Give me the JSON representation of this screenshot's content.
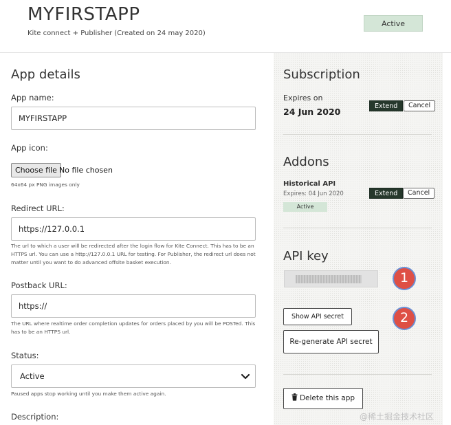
{
  "header": {
    "app_title": "MYFIRSTAPP",
    "subtitle": "Kite connect + Publisher (Created on 24 may 2020)",
    "status": "Active"
  },
  "app_details": {
    "heading": "App details",
    "app_name_label": "App name:",
    "app_name_value": "MYFIRSTAPP",
    "app_icon_label": "App icon:",
    "choose_file": "Choose file",
    "file_status": "No file chosen",
    "icon_hint": "64x64 px PNG images only",
    "redirect_label": "Redirect URL:",
    "redirect_value": "https://127.0.0.1",
    "redirect_help": "The url to which a user will be redirected after the login flow for Kite Connect. This has to be an HTTPS url. You can use a http://127.0.0.1 URL for testing. For Publisher, the redirect url does not matter until you want to do advanced offsite basket execution.",
    "postback_label": "Postback URL:",
    "postback_value": "https://",
    "postback_help": "The URL where realtime order completion updates for orders placed by you will be POSTed. This has to be an HTTPS url.",
    "status_label": "Status:",
    "status_value": "Active",
    "status_help": "Paused apps stop working until you make them active again.",
    "description_label": "Description:"
  },
  "subscription": {
    "heading": "Subscription",
    "expires_label": "Expires on",
    "expires_date": "24 Jun 2020",
    "extend": "Extend",
    "cancel": "Cancel"
  },
  "addons": {
    "heading": "Addons",
    "name": "Historical API",
    "expires": "Expires: 04 Jun 2020",
    "status": "Active",
    "extend": "Extend",
    "cancel": "Cancel"
  },
  "api_key": {
    "heading": "API key",
    "show_secret": "Show API secret",
    "regenerate": "Re-generate API secret",
    "delete": "Delete this app"
  },
  "annotations": {
    "callout_1": "1",
    "callout_2": "2"
  },
  "watermark": "@稀土掘金技术社区",
  "colors": {
    "active_pill": "#d4e6d7",
    "extend_button": "#26382c",
    "callout_fill": "#de4f45",
    "callout_border": "#6a8fd4",
    "panel_bg": "#f5f5f3"
  },
  "icons": {
    "select_chevron": "chevron-down-icon",
    "delete": "trash-icon"
  }
}
